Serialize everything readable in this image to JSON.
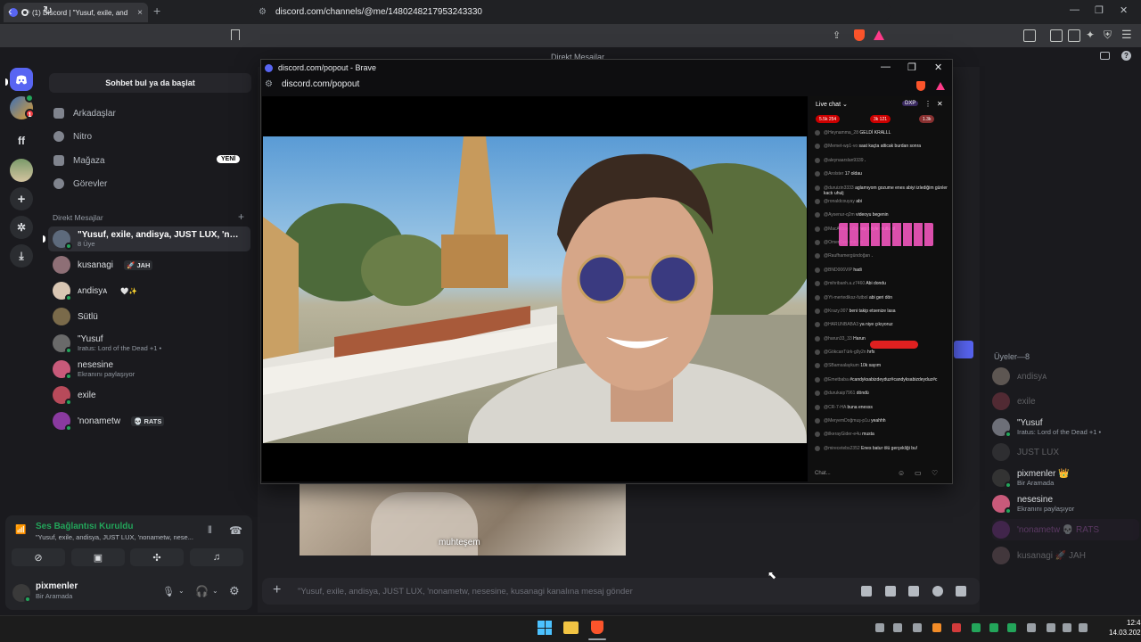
{
  "browser": {
    "tab_title": "(1) Discord | \"Yusuf, exile, and",
    "url": "discord.com/channels/@me/1480248217953243330"
  },
  "discord": {
    "top_title": "Direkt Mesajlar",
    "rail": {
      "ff_label": "ff"
    },
    "search_placeholder": "Sohbet bul ya da başlat",
    "nav": [
      {
        "label": "Arkadaşlar",
        "icon": "friends-icon"
      },
      {
        "label": "Nitro",
        "icon": "nitro-icon"
      },
      {
        "label": "Mağaza",
        "icon": "shop-icon",
        "badge": "YENİ"
      },
      {
        "label": "Görevler",
        "icon": "quests-icon"
      }
    ],
    "dm_header": "Direkt Mesajlar",
    "dms": [
      {
        "name": "\"Yusuf, exile, andisya, JUST LUX, 'nona...",
        "sub": "8 Üye",
        "selected": true
      },
      {
        "name": "kusanagi",
        "tag": "🚀 JAH"
      },
      {
        "name": "ᴀndisyᴀ",
        "tag": "🤍✨"
      },
      {
        "name": "Sütlü"
      },
      {
        "name": "\"Yusuf",
        "sub": "Iratus: Lord of the Dead +1 •"
      },
      {
        "name": "nesesine",
        "sub": "Ekranını paylaşıyor"
      },
      {
        "name": "exile"
      },
      {
        "name": "'nonametw",
        "tag": "💀 RATS"
      }
    ],
    "voice": {
      "title": "Ses Bağlantısı Kuruldu",
      "channel": "\"Yusuf, exile, andisya, JUST LUX, 'nonametw, nese..."
    },
    "user": {
      "name": "pixmenler",
      "status": "Bir Aramada"
    },
    "message_placeholder": "\"Yusuf, exile, andisya, JUST LUX, 'nonametw, nesesine, kusanagi kanalına mesaj gönder",
    "subtitle": "muhteşem",
    "members_header": "Üyeler—8",
    "members": [
      {
        "name": "ᴀndisyᴀ",
        "dim": true
      },
      {
        "name": "exile",
        "dim": true
      },
      {
        "name": "\"Yusuf",
        "sub": "Iratus: Lord of the Dead +1 •"
      },
      {
        "name": "JUST LUX",
        "dim": true
      },
      {
        "name": "pixmenler 👑",
        "sub": "Bir Aramada"
      },
      {
        "name": "nesesine",
        "sub": "Ekranını paylaşıyor"
      },
      {
        "name": "'nonametw 💀 RATS",
        "dim": true
      },
      {
        "name": "kusanagi 🚀 JAH",
        "dim": true
      }
    ]
  },
  "popout": {
    "window_title": "discord.com/popout - Brave",
    "url": "discord.com/popout",
    "livechat": {
      "header": "Live chat",
      "dxp": "DXP",
      "pills": [
        "5.5k 254",
        "3k 121",
        "1.3k"
      ],
      "messages": [
        {
          "user": "@Heynamma_28",
          "text": "GELDİ KRALLL"
        },
        {
          "user": "@Memet-wp1-vo",
          "text": "saat kaçta atticak burdan sonra"
        },
        {
          "user": "@aleynaarslan9339",
          "text": "."
        },
        {
          "user": "@Arolster",
          "text": "17 oldau"
        },
        {
          "user": "@duruizin3333",
          "text": "aglamıyom gozume enes abiyi izlediğim günler kactı uhulj"
        },
        {
          "user": "@ronaldcouyay",
          "text": "abi"
        },
        {
          "user": "@Aysenur-q2m",
          "text": "videoyu begenin"
        },
        {
          "user": "@MacAkbay-u9p",
          "text": "hep böyle mutlu ol"
        },
        {
          "user": "@OmerOzdemir-9p",
          "text": ""
        },
        {
          "user": "@Raufhamergündoğan",
          "text": "."
        },
        {
          "user": "@BND006VIP",
          "text": "hadi"
        },
        {
          "user": "@mihribanh.a.z7460",
          "text": "Abi dondu"
        },
        {
          "user": "@Yt-mertediksz-futbol",
          "text": "abi geri dön"
        },
        {
          "user": "@Krazy.007",
          "text": "beni takip etsenize lasa"
        },
        {
          "user": "@HARUNBABA3",
          "text": "ya niye çıkıyoruz"
        },
        {
          "user": "@harun33_33",
          "text": "Harun"
        },
        {
          "user": "@GökcanTürk-g9y2n",
          "text": "hrfx"
        },
        {
          "user": "@SBamsalaykum",
          "text": "10k sayım"
        },
        {
          "user": "@Emetbaba",
          "text": "#candyksabizdeyduz#candyksabizdeyduz#c"
        },
        {
          "user": "@durukaip7961",
          "text": "döndü"
        },
        {
          "user": "@CR-7-HA",
          "text": "buna enesss"
        },
        {
          "user": "@MeryemDoğmuş-p1u",
          "text": "yeahhh"
        },
        {
          "user": "@ilkerayGider-e4u",
          "text": "musta"
        },
        {
          "user": "@mirecetebs2352",
          "text": "Enes batur ölü gerçekliği bu!"
        }
      ],
      "input_placeholder": "Chat..."
    }
  },
  "taskbar": {
    "time": "12:43",
    "date": "14.03.2026"
  }
}
